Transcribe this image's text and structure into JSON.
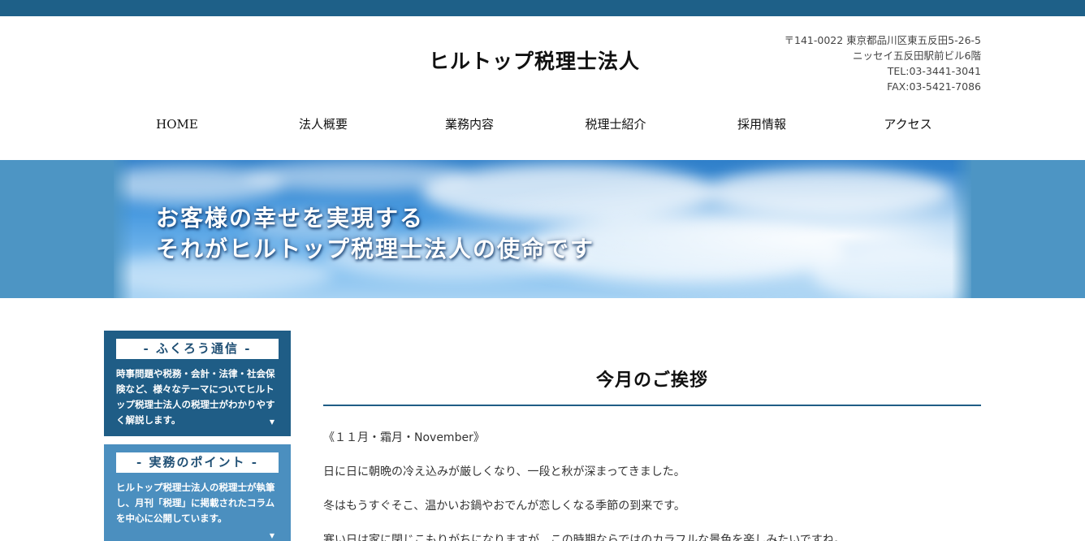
{
  "header": {
    "title": "ヒルトップ税理士法人",
    "address_lines": [
      "〒141-0022 東京都品川区東五反田5-26-5",
      "ニッセイ五反田駅前ビル6階",
      "TEL:03-3441-3041",
      "FAX:03-5421-7086"
    ]
  },
  "nav": {
    "items": [
      {
        "label": "HOME"
      },
      {
        "label": "法人概要"
      },
      {
        "label": "業務内容"
      },
      {
        "label": "税理士紹介"
      },
      {
        "label": "採用情報"
      },
      {
        "label": "アクセス"
      }
    ]
  },
  "hero": {
    "line1": "お客様の幸せを実現する",
    "line2": "それがヒルトップ税理士法人の使命です"
  },
  "sidebar": {
    "boxes": [
      {
        "title": "- ふくろう通信 -",
        "text": "時事問題や税務・会計・法律・社会保険など、様々なテーマについてヒルトップ税理士法人の税理士がわかりやすく解説します。",
        "arrow": "▼"
      },
      {
        "title": "- 実務のポイント -",
        "text": "ヒルトップ税理士法人の税理士が執筆し、月刊「税理」に掲載されたコラムを中心に公開しています。",
        "arrow": "▼"
      }
    ]
  },
  "main": {
    "heading": "今月のご挨拶",
    "paragraphs": [
      "《１１月・霜月・November》",
      "日に日に朝晩の冷え込みが厳しくなり、一段と秋が深まってきました。",
      "冬はもうすぐそこ、温かいお鍋やおでんが恋しくなる季節の到来です。",
      "寒い日は家に閉じこもりがちになりますが、この時期ならではのカラフルな景色を楽しみたいですね。"
    ]
  },
  "colors": {
    "topbar": "#1e6088",
    "accent_dark": "#1f5d86",
    "accent_light": "#4b8fbf",
    "hero_bg": "#4d95c4"
  }
}
